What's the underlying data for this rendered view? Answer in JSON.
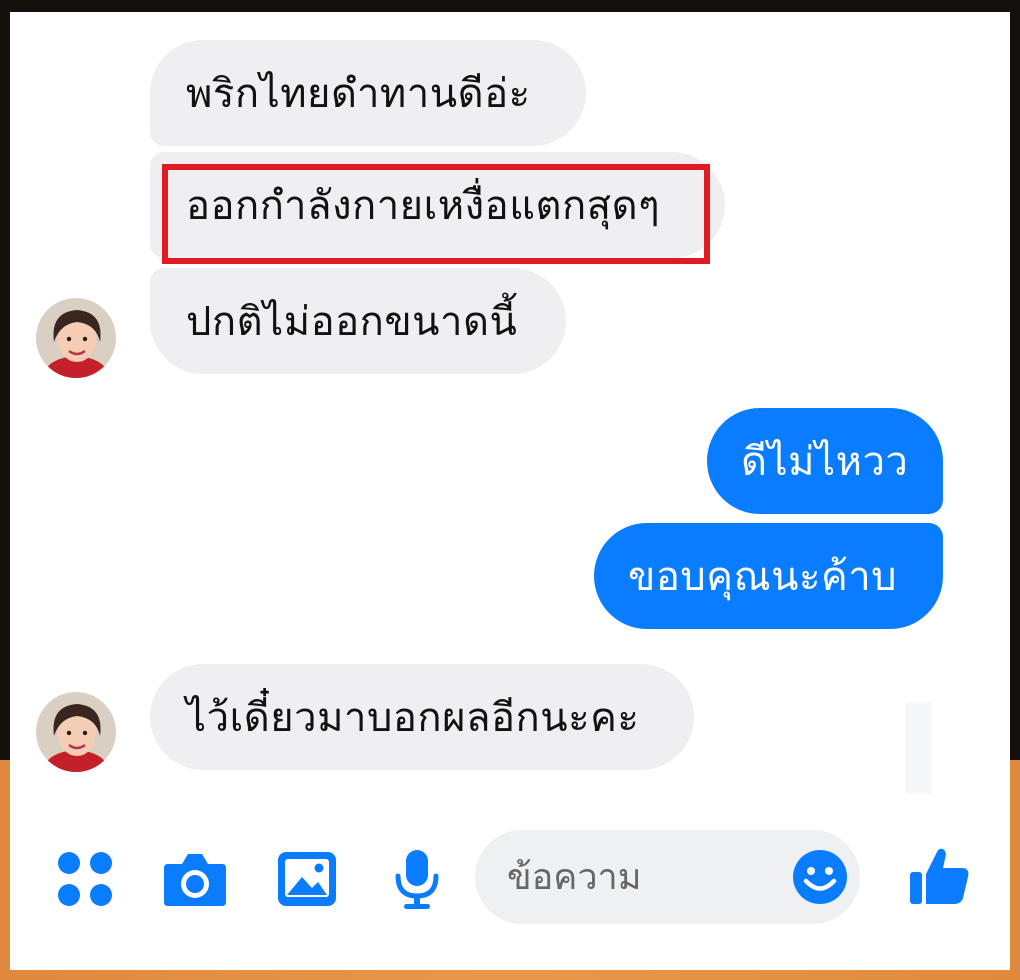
{
  "messages": [
    {
      "id": "m1",
      "direction": "incoming",
      "text": "พริกไทยดำทานดีอ่ะ"
    },
    {
      "id": "m2",
      "direction": "incoming",
      "text": "ออกกำลังกายเหงื่อแตกสุดๆ",
      "highlighted": true
    },
    {
      "id": "m3",
      "direction": "incoming",
      "text": "ปกติไม่ออกขนาดนี้"
    },
    {
      "id": "m4",
      "direction": "outgoing",
      "text": "ดีไม่ไหวว"
    },
    {
      "id": "m5",
      "direction": "outgoing",
      "text": "ขอบคุณนะค้าบ"
    },
    {
      "id": "m6",
      "direction": "incoming",
      "text": "ไว้เดี๋ยวมาบอกผลอีกนะคะ"
    }
  ],
  "composer": {
    "placeholder": "ข้อความ",
    "icons": [
      "apps-icon",
      "camera-icon",
      "photo-icon",
      "microphone-icon",
      "emoji-icon",
      "thumbs-up-icon"
    ]
  },
  "colors": {
    "accent": "#0a7cff",
    "incoming_bubble": "#efeff1",
    "highlight_border": "#e01b24"
  }
}
